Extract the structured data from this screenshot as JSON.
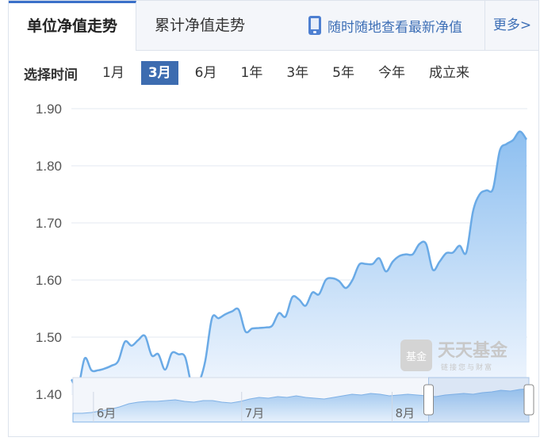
{
  "tabs": {
    "active": "单位净值走势",
    "second": "累计净值走势"
  },
  "promo": {
    "text": "随时随地查看最新净值",
    "icon": "mobile-phone-icon"
  },
  "more": "更多>",
  "range": {
    "label": "选择时间",
    "options": [
      "1月",
      "3月",
      "6月",
      "1年",
      "3年",
      "5年",
      "今年",
      "成立来"
    ],
    "selected": "3月"
  },
  "watermark": {
    "brand": "天天基金",
    "slogan": "链接您与财富",
    "badge": "基金"
  },
  "colors": {
    "accent": "#3d6cb0",
    "line": "#6aaae6",
    "area_top": "#8dbff0",
    "area_bottom": "#f2f7fe"
  },
  "chart_data": {
    "type": "area",
    "ylim": [
      1.38,
      1.9
    ],
    "yticks": [
      "1.90",
      "1.80",
      "1.70",
      "1.60",
      "1.50",
      "1.40"
    ],
    "ytick_values": [
      1.9,
      1.8,
      1.7,
      1.6,
      1.5,
      1.4
    ],
    "grid": true,
    "navigator": {
      "labels": [
        "6月",
        "7月",
        "8月"
      ],
      "selected_fraction": [
        0.78,
        1.0
      ]
    },
    "values": [
      1.426,
      1.413,
      1.463,
      1.442,
      1.442,
      1.445,
      1.45,
      1.458,
      1.492,
      1.485,
      1.495,
      1.502,
      1.468,
      1.47,
      1.443,
      1.472,
      1.47,
      1.465,
      1.416,
      1.42,
      1.458,
      1.533,
      1.533,
      1.54,
      1.545,
      1.548,
      1.51,
      1.515,
      1.516,
      1.517,
      1.52,
      1.542,
      1.536,
      1.57,
      1.566,
      1.555,
      1.578,
      1.575,
      1.6,
      1.603,
      1.598,
      1.586,
      1.6,
      1.627,
      1.628,
      1.628,
      1.638,
      1.615,
      1.632,
      1.642,
      1.645,
      1.645,
      1.663,
      1.663,
      1.618,
      1.632,
      1.647,
      1.648,
      1.66,
      1.648,
      1.72,
      1.75,
      1.757,
      1.76,
      1.826,
      1.838,
      1.845,
      1.86,
      1.846
    ]
  }
}
